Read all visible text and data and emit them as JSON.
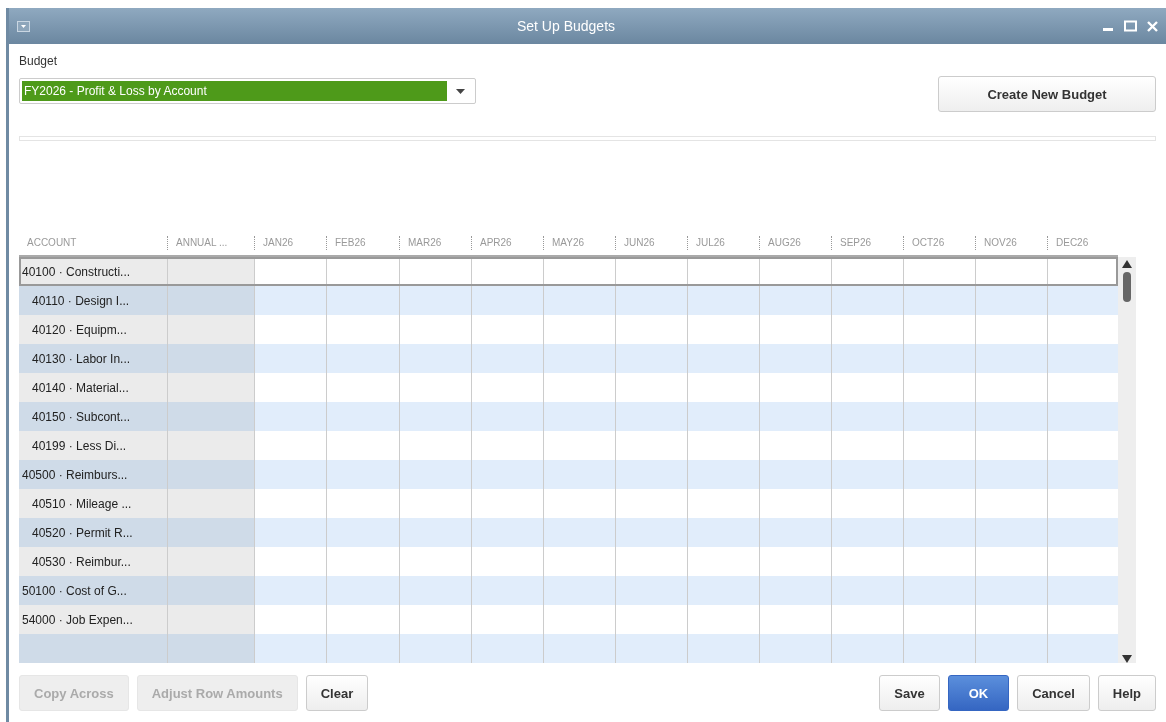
{
  "window": {
    "title": "Set Up Budgets"
  },
  "budget": {
    "label": "Budget",
    "value": "FY2026 - Profit & Loss by Account"
  },
  "create_button": "Create New Budget",
  "table": {
    "columns": [
      "ACCOUNT",
      "ANNUAL ...",
      "JAN26",
      "FEB26",
      "MAR26",
      "APR26",
      "MAY26",
      "JUN26",
      "JUL26",
      "AUG26",
      "SEP26",
      "OCT26",
      "NOV26",
      "DEC26"
    ],
    "rows": [
      {
        "account": "40100 · Constructi...",
        "selected": true,
        "children": [
          {
            "account": "40110 · Design I...",
            "selected": false
          },
          {
            "account": "40120 · Equipm...",
            "selected": false
          },
          {
            "account": "40130 · Labor In...",
            "selected": false
          },
          {
            "account": "40140 · Material...",
            "selected": false
          },
          {
            "account": "40150 · Subcont...",
            "selected": false
          },
          {
            "account": "40199 · Less Di...",
            "selected": false
          }
        ]
      },
      {
        "account": "40500 · Reimburs...",
        "selected": false,
        "children": [
          {
            "account": "40510 · Mileage ...",
            "selected": false
          },
          {
            "account": "40520 · Permit R...",
            "selected": false
          },
          {
            "account": "40530 · Reimbur...",
            "selected": false
          }
        ]
      },
      {
        "account": "50100 · Cost of G...",
        "selected": false
      },
      {
        "account": "54000 · Job Expen...",
        "selected": false
      }
    ]
  },
  "left_buttons": [
    {
      "label": "Copy Across",
      "disabled": true
    },
    {
      "label": "Adjust Row Amounts",
      "disabled": true
    },
    {
      "label": "Clear",
      "disabled": false
    }
  ],
  "right_buttons": [
    {
      "label": "Save",
      "kind": "normal"
    },
    {
      "label": "OK",
      "kind": "primary"
    },
    {
      "label": "Cancel",
      "kind": "normal"
    },
    {
      "label": "Help",
      "kind": "normal"
    }
  ]
}
